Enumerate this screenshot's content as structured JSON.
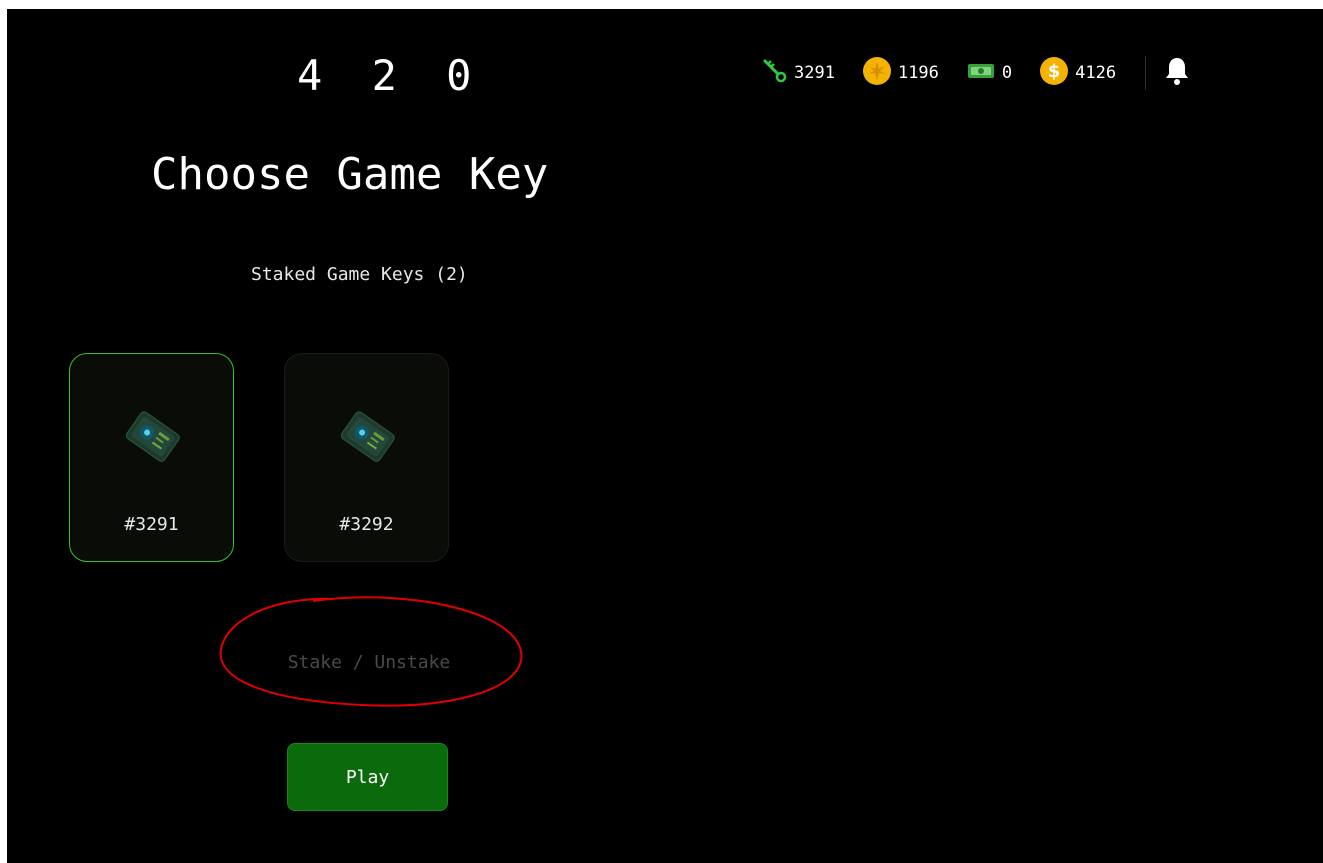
{
  "app": {
    "logo": "4 2 0"
  },
  "topbar": {
    "stats": [
      {
        "icon": "key-icon",
        "value": "3291",
        "color": "#2ecc40"
      },
      {
        "icon": "leaf-coin-icon",
        "value": "1196",
        "color": "#f5b301"
      },
      {
        "icon": "cash-icon",
        "value": "0",
        "color": "#3aa13a"
      },
      {
        "icon": "dollar-coin-icon",
        "value": "4126",
        "color": "#f5b301"
      }
    ],
    "notifications_icon": "bell-icon"
  },
  "main": {
    "title": "Choose Game Key",
    "section_label": "Staked Game Keys (2)",
    "keys": [
      {
        "label": "#3291",
        "selected": true
      },
      {
        "label": "#3292",
        "selected": false
      }
    ],
    "stake_label": "Stake / Unstake",
    "play_label": "Play"
  },
  "colors": {
    "background": "#000000",
    "accent_green": "#3bbf2f",
    "play_button": "#0b6a0b",
    "annotation_red": "#e00000"
  }
}
